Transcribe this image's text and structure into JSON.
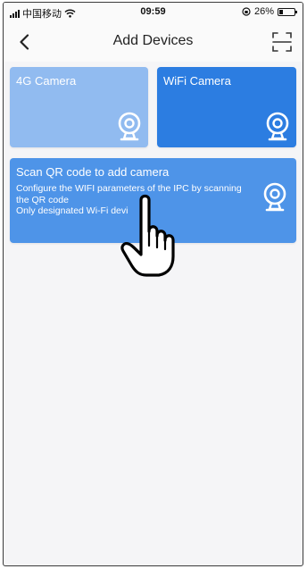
{
  "status_bar": {
    "carrier": "中国移动",
    "time": "09:59",
    "battery_percent": "26%",
    "battery_level": 0.26
  },
  "nav": {
    "title": "Add Devices",
    "back_icon": "chevron-left-icon",
    "scan_icon": "scan-frame-icon"
  },
  "cards": {
    "g4": {
      "label": "4G Camera",
      "icon": "camera-icon",
      "color": "#91bbf0"
    },
    "wifi": {
      "label": "WiFi Camera",
      "icon": "camera-icon",
      "color": "#2c7de1"
    },
    "qr": {
      "title": "Scan QR code to add camera",
      "desc_line1": "Configure the WIFI parameters of the IPC by scanning",
      "desc_line2": "the QR code",
      "desc_line3": "Only designated Wi-Fi devi",
      "icon": "camera-icon",
      "color": "#4e94e8"
    }
  },
  "overlay": {
    "icon": "pointing-hand-icon"
  }
}
